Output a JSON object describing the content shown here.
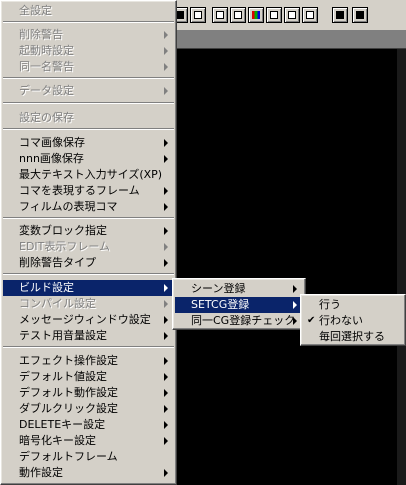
{
  "main_menu": {
    "items": [
      {
        "label": "全設定",
        "disabled": true,
        "arrow": false
      },
      {
        "label": "削除警告",
        "disabled": true,
        "arrow": true
      },
      {
        "label": "起動時設定",
        "disabled": true,
        "arrow": true
      },
      {
        "label": "同一名警告",
        "disabled": true,
        "arrow": true
      },
      {
        "label": "データ設定",
        "disabled": true,
        "arrow": true
      },
      {
        "label": "設定の保存",
        "disabled": true,
        "arrow": false
      },
      {
        "label": "コマ画像保存",
        "disabled": false,
        "arrow": true
      },
      {
        "label": "nnn画像保存",
        "disabled": false,
        "arrow": true
      },
      {
        "label": "最大テキスト入力サイズ(XP)",
        "disabled": false,
        "arrow": false
      },
      {
        "label": "コマを表現するフレーム",
        "disabled": false,
        "arrow": true
      },
      {
        "label": "フィルムの表現コマ",
        "disabled": false,
        "arrow": true
      },
      {
        "label": "変数ブロック指定",
        "disabled": false,
        "arrow": true
      },
      {
        "label": "EDIT表示フレーム",
        "disabled": true,
        "arrow": true
      },
      {
        "label": "削除警告タイプ",
        "disabled": false,
        "arrow": true
      },
      {
        "label": "ビルド設定",
        "disabled": false,
        "arrow": true,
        "highlighted": true
      },
      {
        "label": "コンパイル設定",
        "disabled": true,
        "arrow": true
      },
      {
        "label": "メッセージウィンドウ設定",
        "disabled": false,
        "arrow": true
      },
      {
        "label": "テスト用音量設定",
        "disabled": false,
        "arrow": true
      },
      {
        "label": "エフェクト操作設定",
        "disabled": false,
        "arrow": true
      },
      {
        "label": "デフォルト値設定",
        "disabled": false,
        "arrow": true
      },
      {
        "label": "デフォルト動作設定",
        "disabled": false,
        "arrow": true
      },
      {
        "label": "ダブルクリック設定",
        "disabled": false,
        "arrow": true
      },
      {
        "label": "DELETEキー設定",
        "disabled": false,
        "arrow": true
      },
      {
        "label": "暗号化キー設定",
        "disabled": false,
        "arrow": true
      },
      {
        "label": "デフォルトフレーム",
        "disabled": false,
        "arrow": false
      },
      {
        "label": "動作設定",
        "disabled": false,
        "arrow": true
      }
    ]
  },
  "build_submenu": {
    "items": [
      {
        "label": "シーン登録",
        "arrow": true
      },
      {
        "label": "SETCG登録",
        "arrow": true,
        "highlighted": true
      },
      {
        "label": "同一CG登録チェック",
        "arrow": true
      }
    ]
  },
  "setcg_submenu": {
    "items": [
      {
        "label": "行う",
        "checked": false
      },
      {
        "label": "行わない",
        "checked": true
      },
      {
        "label": "毎回選択する",
        "checked": false
      }
    ]
  },
  "toolbar_icons": [
    "grid-icon",
    "window-icon",
    "list-icon",
    "page-icon",
    "color-bars-icon",
    "caption-icon",
    "document-icon",
    "text-icon",
    "layout-icon"
  ],
  "colors": {
    "menu_bg": "#d4d0c8",
    "highlight": "#0a246a",
    "disabled_text": "#808080"
  }
}
